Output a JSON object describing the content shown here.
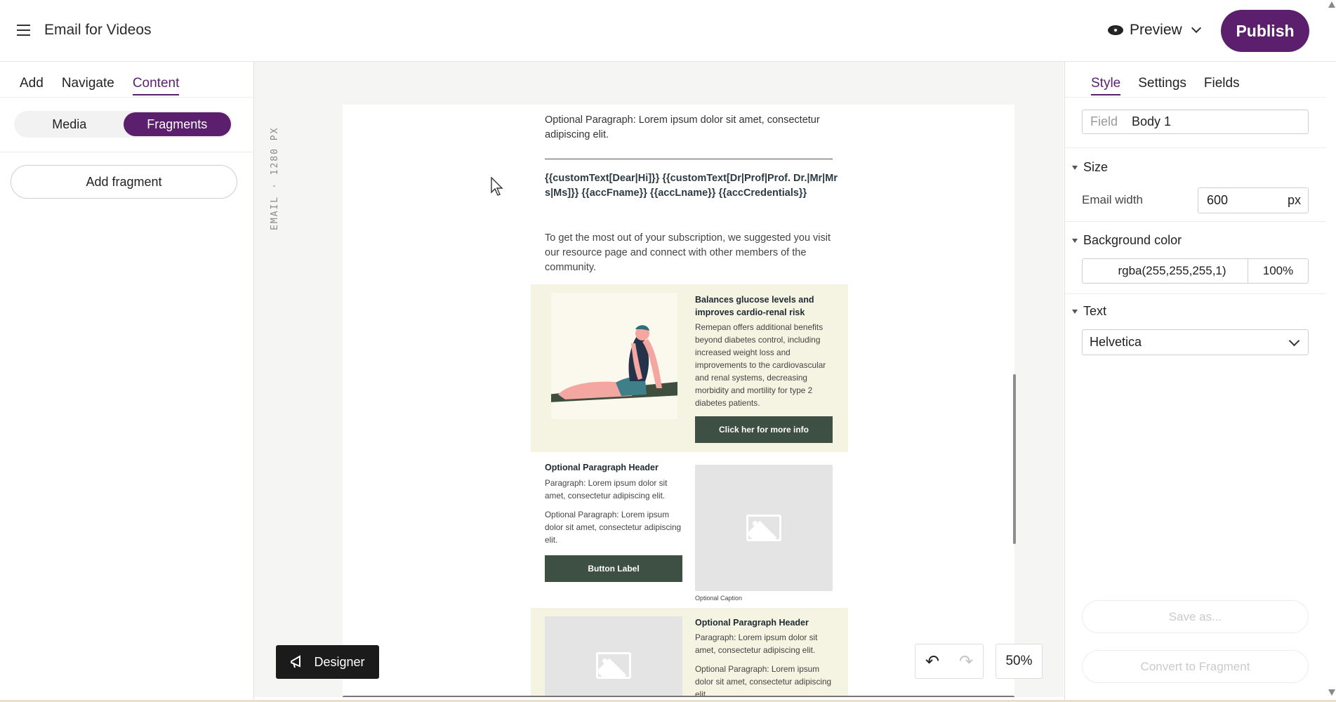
{
  "header": {
    "menu_icon": "hamburger-menu-icon",
    "title": "Email for Videos",
    "preview_label": "Preview",
    "publish_label": "Publish"
  },
  "left_panel": {
    "tabs": [
      {
        "label": "Add",
        "active": false
      },
      {
        "label": "Navigate",
        "active": false
      },
      {
        "label": "Content",
        "active": true
      }
    ],
    "segments": [
      {
        "label": "Media",
        "active": false
      },
      {
        "label": "Fragments",
        "active": true
      }
    ],
    "add_fragment_label": "Add fragment"
  },
  "canvas": {
    "ruler_label": "EMAIL · 1280 PX",
    "email": {
      "top_optional_paragraph": "Optional Paragraph: Lorem ipsum dolor sit amet, consectetur adipiscing elit.",
      "merge_fields": "{{customText[Dear|Hi]}} {{customText[Dr|Prof|Prof. Dr.|Mr|Mrs|Ms]}} {{accFname}} {{accLname}} {{accCredentials}}",
      "intro": "To get the most out of your subscription, we suggested you visit our resource page and connect with other members of the community.",
      "block1": {
        "title": "Balances glucose levels and improves cardio-renal risk",
        "text": "Remepan offers additional benefits beyond diabetes control, including increased weight loss and improvements to the cardiovascular and renal systems, decreasing morbidity and mortility for type 2 diabetes patients.",
        "button": "Click her for more info"
      },
      "block2": {
        "title": "Optional Paragraph Header",
        "paragraph": "Paragraph: Lorem ipsum dolor sit amet, consectetur adipiscing elit.",
        "optional": "Optional Paragraph: Lorem ipsum dolor sit amet, consectetur adipiscing elit.",
        "button": "Button Label",
        "caption": "Optional Caption"
      },
      "block3": {
        "title": "Optional Paragraph Header",
        "paragraph": "Paragraph: Lorem ipsum dolor sit amet, consectetur adipiscing elit.",
        "optional": "Optional Paragraph: Lorem ipsum dolor sit amet, consectetur adipiscing elit."
      }
    },
    "designer_label": "Designer",
    "zoom": "50%"
  },
  "right_panel": {
    "tabs": [
      {
        "label": "Style",
        "active": true
      },
      {
        "label": "Settings",
        "active": false
      },
      {
        "label": "Fields",
        "active": false
      }
    ],
    "field_label": "Field",
    "field_value": "Body 1",
    "size_heading": "Size",
    "email_width_label": "Email width",
    "email_width_value": "600",
    "email_width_unit": "px",
    "bg_heading": "Background color",
    "bg_value": "rgba(255,255,255,1)",
    "bg_opacity": "100%",
    "text_heading": "Text",
    "font_value": "Helvetica",
    "save_as_label": "Save as...",
    "convert_label": "Convert to Fragment"
  },
  "colors": {
    "accent": "#5b1f6e",
    "email_button": "#3e4f43",
    "email_block_bg": "#f5f3e1"
  }
}
